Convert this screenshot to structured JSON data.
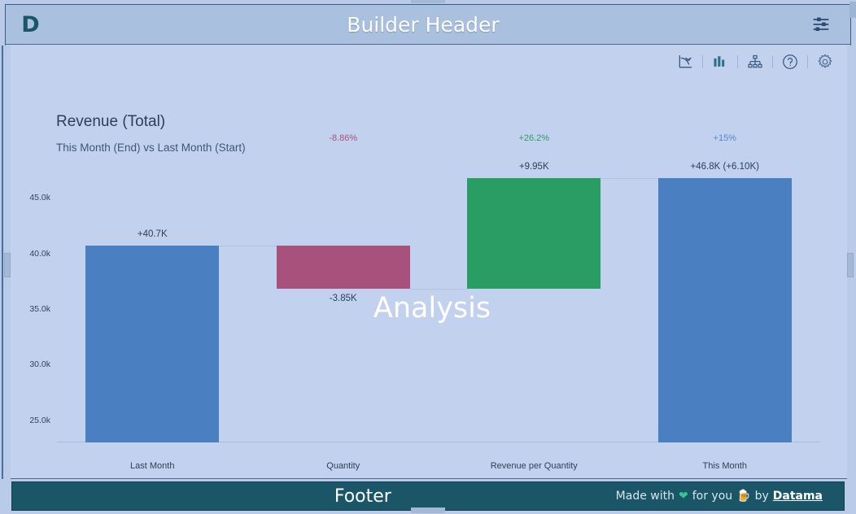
{
  "header": {
    "logo": "D",
    "logo_icon": "datama-logo-icon",
    "title": "Builder Header",
    "settings_icon": "sliders-icon"
  },
  "toolbar": {
    "icons": [
      {
        "name": "trend-chart-icon",
        "label": "Trend"
      },
      {
        "name": "bar-chart-icon",
        "label": "Bar chart"
      },
      {
        "name": "hierarchy-icon",
        "label": "Hierarchy"
      },
      {
        "name": "help-icon",
        "label": "Help"
      },
      {
        "name": "gear-icon",
        "label": "Settings"
      }
    ]
  },
  "chart_data": {
    "type": "bar",
    "title": "Revenue (Total)",
    "subtitle": "This Month (End) vs Last Month (Start)",
    "xlabel": "",
    "ylabel": "",
    "ylim": [
      23000,
      47500
    ],
    "grid": false,
    "legend": "none",
    "watermark": "Analysis",
    "categories": [
      "Last Month",
      "Quantity",
      "Revenue per Quantity",
      "This Month"
    ],
    "ytick_labels": [
      "45.0k",
      "40.0k",
      "35.0k",
      "30.0k",
      "25.0k"
    ],
    "ytick_values": [
      45000,
      40000,
      35000,
      30000,
      25000
    ],
    "bars": [
      {
        "category": "Last Month",
        "kind": "total",
        "start": 23000,
        "end": 40700,
        "value": 40700,
        "value_label": "+40.7K",
        "pct_label": "",
        "color": "#4a7fc1",
        "label_position": "above"
      },
      {
        "category": "Quantity",
        "kind": "decrease",
        "start": 40700,
        "end": 36850,
        "value": -3850,
        "value_label": "-3.85K",
        "pct_label": "-8.86%",
        "color": "#a9517d",
        "label_position": "below"
      },
      {
        "category": "Revenue per Quantity",
        "kind": "increase",
        "start": 36850,
        "end": 46800,
        "value": 9950,
        "value_label": "+9.95K",
        "pct_label": "+26.2%",
        "color": "#2a9d65",
        "label_position": "above"
      },
      {
        "category": "This Month",
        "kind": "total",
        "start": 23000,
        "end": 46800,
        "value": 46800,
        "value_label": "+46.8K (+6.10K)",
        "pct_label": "+15%",
        "color": "#4a7fc1",
        "label_position": "above"
      }
    ],
    "pct_colors": {
      "decrease": "#a9517d",
      "increase": "#2a9d65",
      "total": "#5b86c9"
    }
  },
  "footer": {
    "title": "Footer",
    "credit_prefix": "Made with",
    "heart_icon": "heart-icon",
    "credit_middle": "for you",
    "beer_icon": "beer-icon",
    "credit_by": "by",
    "brand": "Datama"
  }
}
